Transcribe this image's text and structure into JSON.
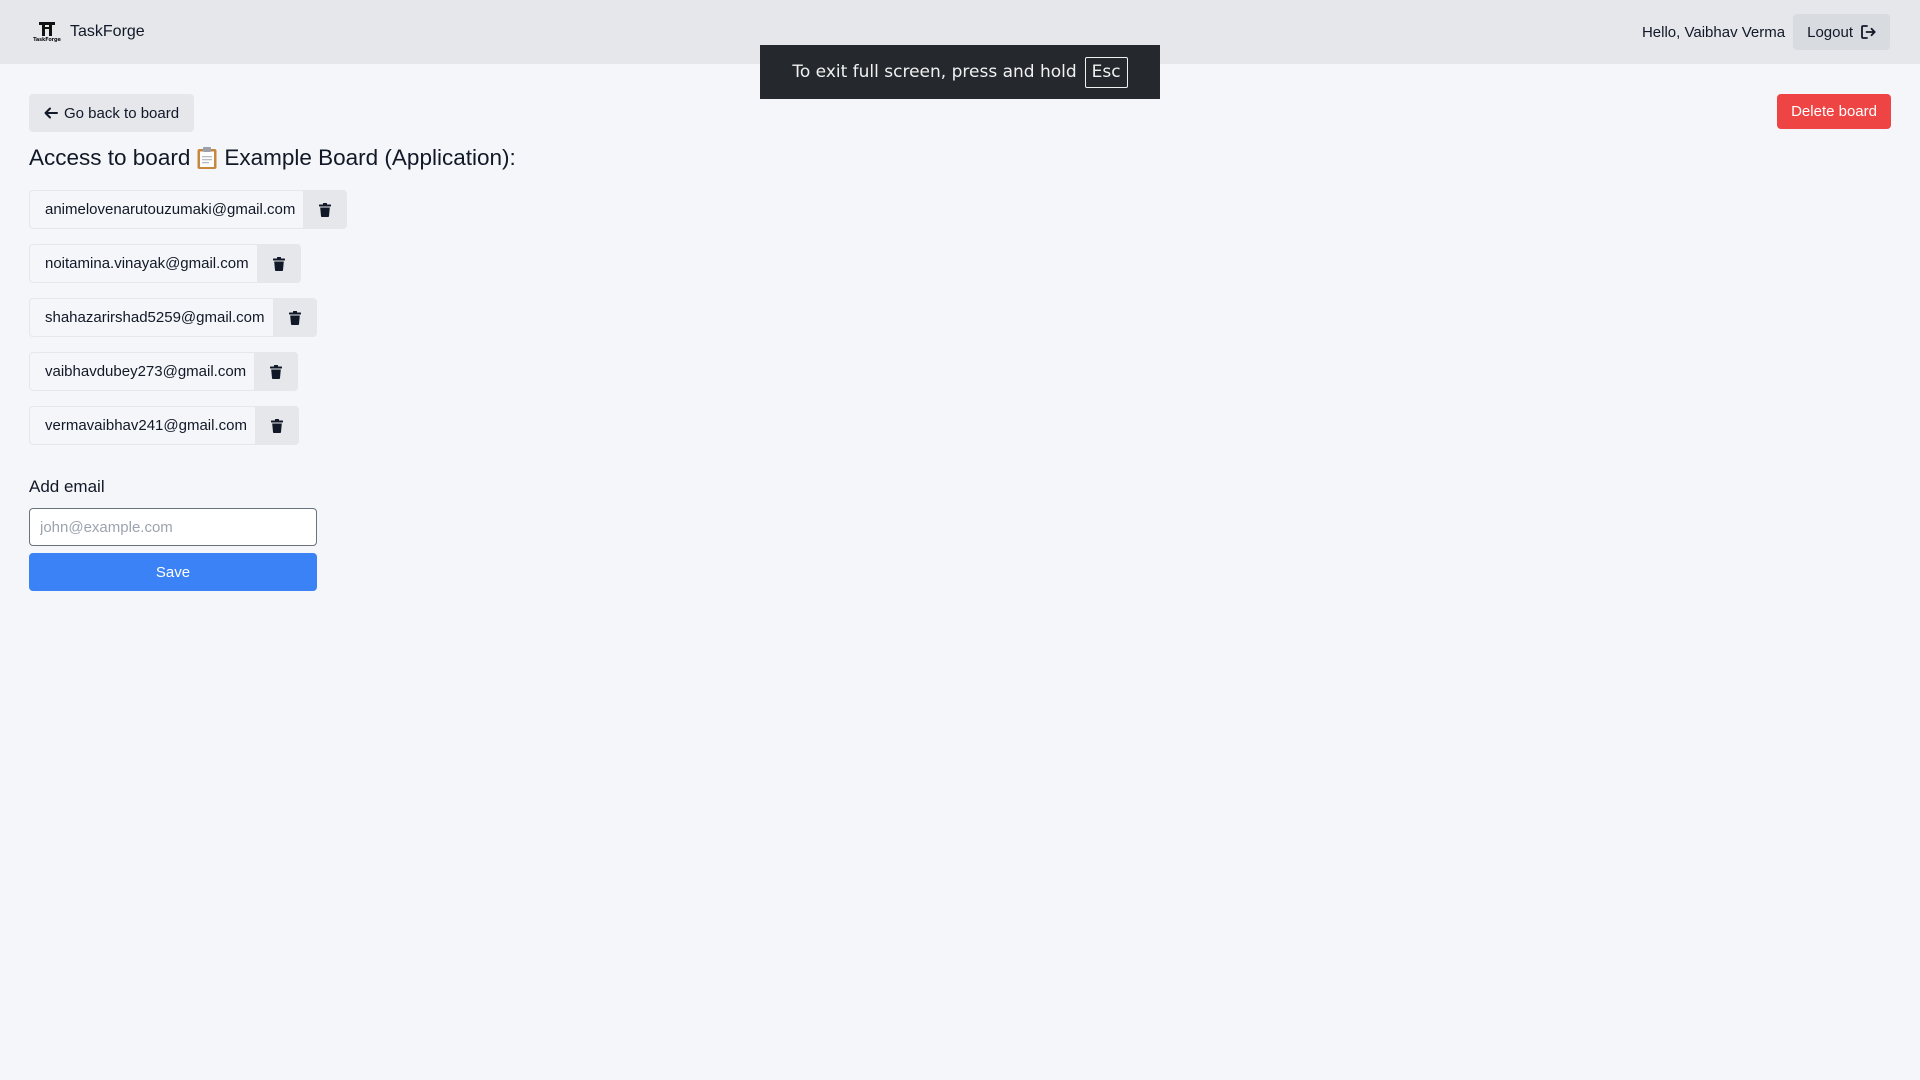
{
  "navbar": {
    "logo_caption": "TaskForge",
    "brand_name": "TaskForge",
    "greeting": "Hello, Vaibhav Verma",
    "logout_label": "Logout",
    "logout_icon": "sign-out-icon"
  },
  "fullscreen_banner": {
    "message": "To exit full screen, press and hold",
    "key": "Esc"
  },
  "toolbar": {
    "back_label": "Go back to board",
    "back_icon": "arrow-left-icon",
    "delete_label": "Delete board"
  },
  "page": {
    "title_prefix": "Access to board",
    "title_icon": "clipboard-icon",
    "title_suffix": "Example Board (Application):"
  },
  "access_list": [
    {
      "email": "animelovenarutouzumaki@gmail.com"
    },
    {
      "email": "noitamina.vinayak@gmail.com"
    },
    {
      "email": "shahazarirshad5259@gmail.com"
    },
    {
      "email": "vaibhavdubey273@gmail.com"
    },
    {
      "email": "vermavaibhav241@gmail.com"
    }
  ],
  "add_form": {
    "label": "Add email",
    "value": "",
    "placeholder": "john@example.com",
    "save_label": "Save"
  },
  "colors": {
    "navbar_bg": "#e5e7eb",
    "page_bg": "#f5f6f9",
    "danger": "#ef4444",
    "primary": "#3b82f6"
  }
}
